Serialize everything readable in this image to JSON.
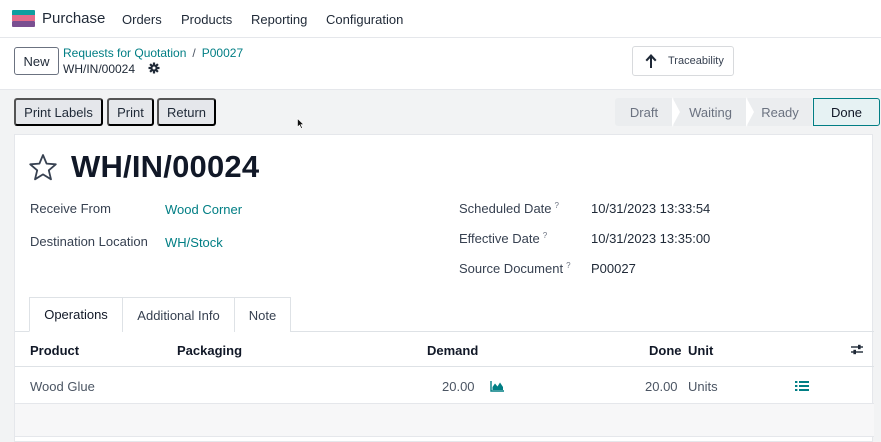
{
  "navbar": {
    "app_name": "Purchase",
    "menu": [
      "Orders",
      "Products",
      "Reporting",
      "Configuration"
    ],
    "logo_colors": [
      "#0f9ea0",
      "#e46b8a",
      "#7a4f91"
    ]
  },
  "control": {
    "new_label": "New",
    "breadcrumbs": [
      "Requests for Quotation",
      "P00027"
    ],
    "breadcrumb_separator": "/",
    "current": "WH/IN/00024",
    "traceability_label": "Traceability"
  },
  "actions": {
    "print_labels": "Print Labels",
    "print": "Print",
    "return": "Return"
  },
  "status": {
    "stages": [
      "Draft",
      "Waiting",
      "Ready",
      "Done"
    ],
    "active": "Done",
    "accent": "#017e84"
  },
  "record": {
    "title": "WH/IN/00024",
    "fields_left": [
      {
        "label": "Receive From",
        "value": "Wood Corner"
      },
      {
        "label": "Destination Location",
        "value": "WH/Stock"
      }
    ],
    "fields_right": [
      {
        "label": "Scheduled Date",
        "help": "?",
        "value": "10/31/2023 13:33:54"
      },
      {
        "label": "Effective Date",
        "help": "?",
        "value": "10/31/2023 13:35:00"
      },
      {
        "label": "Source Document",
        "help": "?",
        "value": "P00027"
      }
    ]
  },
  "tabs": [
    "Operations",
    "Additional Info",
    "Note"
  ],
  "table": {
    "columns": [
      "Product",
      "Packaging",
      "Demand",
      "Done",
      "Unit"
    ],
    "rows": [
      {
        "product": "Wood Glue",
        "packaging": "",
        "demand": "20.00",
        "done": "20.00",
        "unit": "Units"
      }
    ]
  }
}
